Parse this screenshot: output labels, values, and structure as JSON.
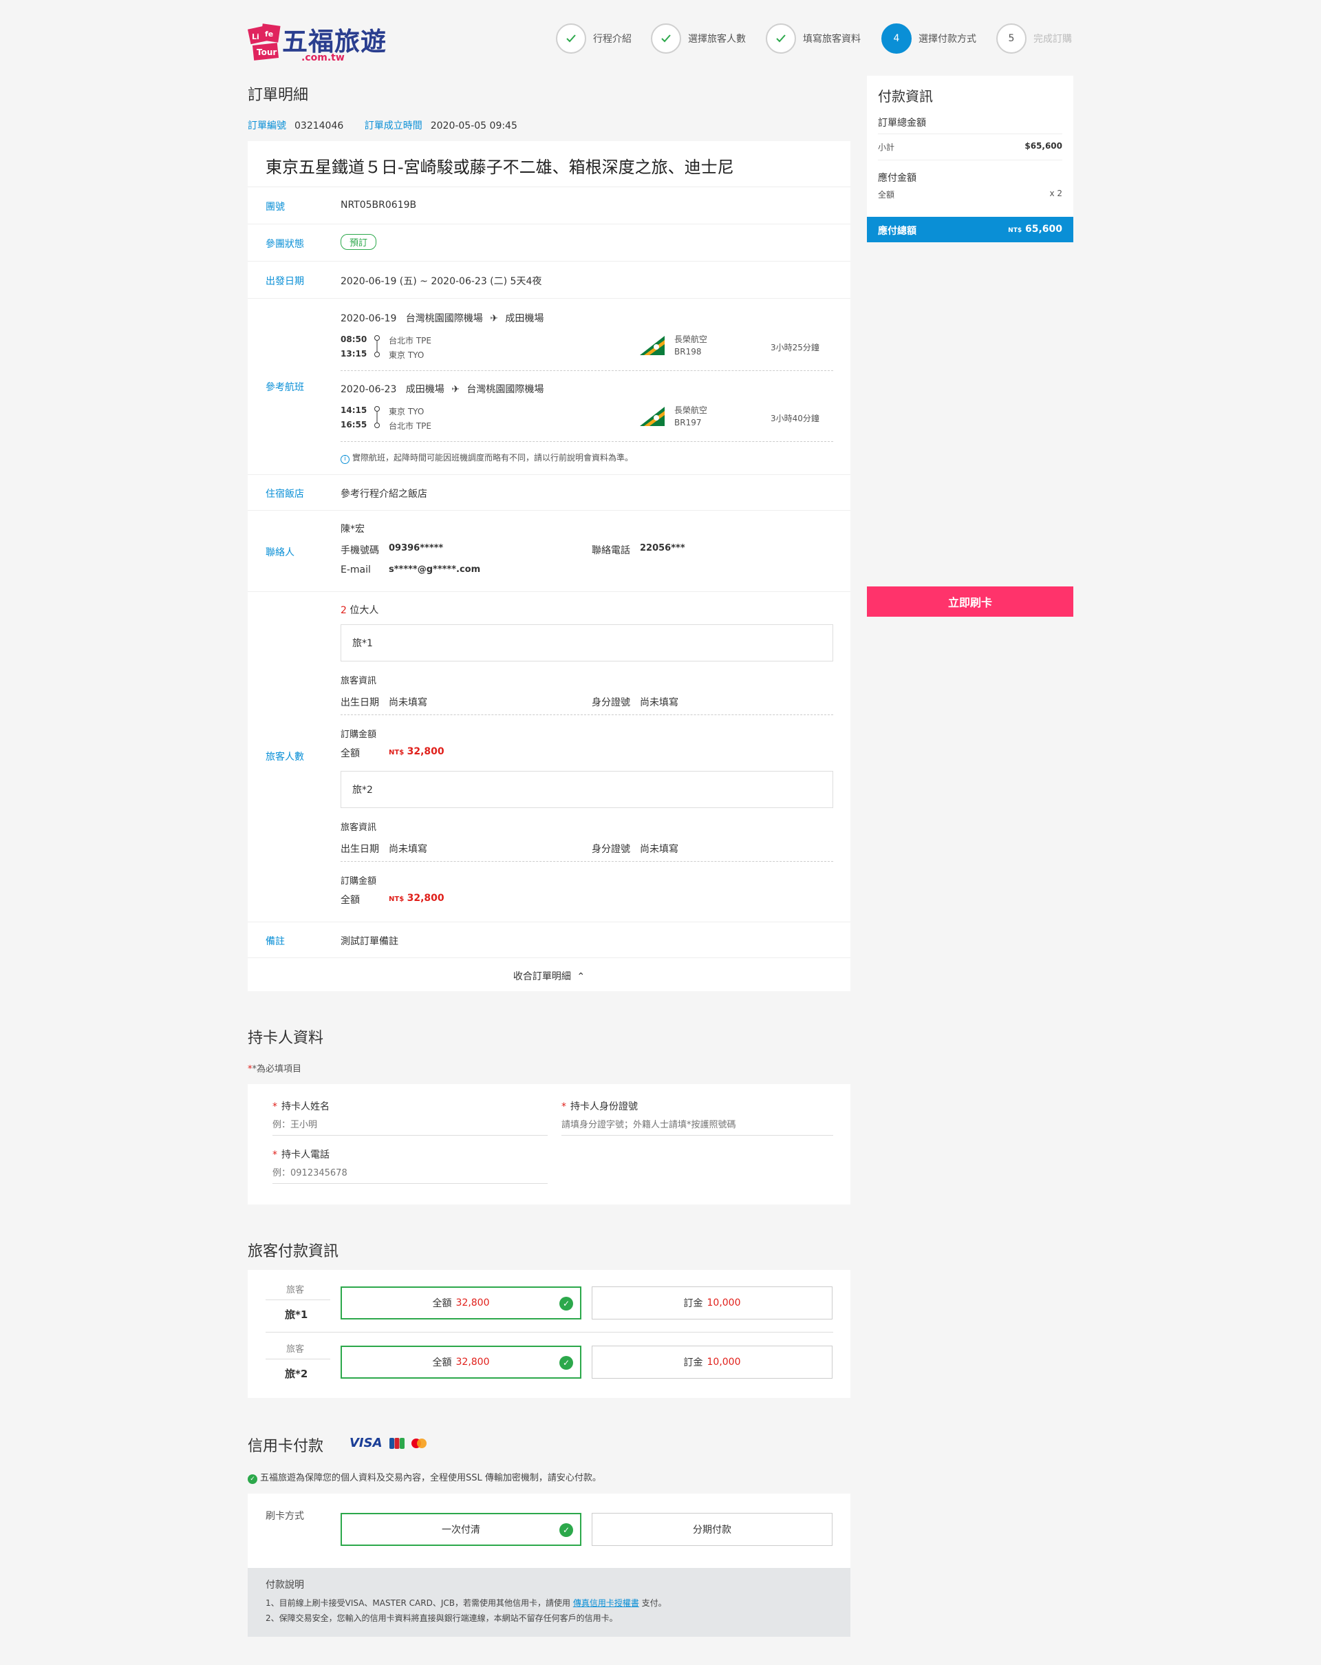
{
  "brand": {
    "logo_badge": "Life Tour",
    "name": "五福旅遊",
    "domain": ".com.tw"
  },
  "steps": [
    {
      "label": "行程介紹",
      "status": "done"
    },
    {
      "label": "選擇旅客人數",
      "status": "done"
    },
    {
      "label": "填寫旅客資料",
      "status": "done"
    },
    {
      "num": "4",
      "label": "選擇付款方式",
      "status": "active"
    },
    {
      "num": "5",
      "label": "完成訂購",
      "status": "pending"
    }
  ],
  "order": {
    "heading": "訂單明細",
    "id_label": "訂單編號",
    "id": "03214046",
    "created_label": "訂單成立時間",
    "created": "2020-05-05 09:45",
    "title": "東京五星鐵道５日-宮崎駿或藤子不二雄、箱根深度之旅、迪士尼",
    "group_label": "團號",
    "group": "NRT05BR0619B",
    "status_label": "參團狀態",
    "status": "預訂",
    "dates_label": "出發日期",
    "dates": "2020-06-19 (五) ~ 2020-06-23 (二) 5天4夜",
    "flights_label": "參考航班",
    "flights": [
      {
        "date": "2020-06-19",
        "from": "台灣桃園國際機場",
        "to": "成田機場",
        "dep_time": "08:50",
        "dep_place": "台北市 TPE",
        "arr_time": "13:15",
        "arr_place": "東京 TYO",
        "airline": "長榮航空",
        "code": "BR198",
        "duration": "3小時25分鐘"
      },
      {
        "date": "2020-06-23",
        "from": "成田機場",
        "to": "台灣桃園國際機場",
        "dep_time": "14:15",
        "dep_place": "東京 TYO",
        "arr_time": "16:55",
        "arr_place": "台北市 TPE",
        "airline": "長榮航空",
        "code": "BR197",
        "duration": "3小時40分鐘"
      }
    ],
    "flight_note": "實際航班，起降時間可能因班機調度而略有不同，請以行前說明會資料為準。",
    "hotel_label": "住宿飯店",
    "hotel": "參考行程介紹之飯店",
    "contact_label": "聯絡人",
    "contact": {
      "name": "陳*宏",
      "mobile_label": "手機號碼",
      "mobile": "09396*****",
      "phone_label": "聯絡電話",
      "phone": "22056***",
      "email_label": "E-mail",
      "email": "s*****@g*****.com"
    },
    "travelers_label": "旅客人數",
    "adult_count": "2",
    "adult_suffix": "位大人",
    "travelers": [
      {
        "name": "旅*1",
        "info_label": "旅客資訊",
        "birth_label": "出生日期",
        "birth": "尚未填寫",
        "idno_label": "身分證號",
        "idno": "尚未填寫",
        "amount_label": "訂購金額",
        "full_label": "全額",
        "currency": "NT$",
        "amount": "32,800"
      },
      {
        "name": "旅*2",
        "info_label": "旅客資訊",
        "birth_label": "出生日期",
        "birth": "尚未填寫",
        "idno_label": "身分證號",
        "idno": "尚未填寫",
        "amount_label": "訂購金額",
        "full_label": "全額",
        "currency": "NT$",
        "amount": "32,800"
      }
    ],
    "remark_label": "備註",
    "remark": "測試訂單備註",
    "collapse": "收合訂單明細"
  },
  "payment_info": {
    "heading": "付款資訊",
    "total_label": "訂單總金額",
    "subtotal_label": "小計",
    "subtotal": "$65,600",
    "due_label": "應付金額",
    "full_label": "全額",
    "qty": "x 2",
    "grand_label": "應付總額",
    "grand_currency": "NT$",
    "grand": "65,600",
    "swipe": "立即刷卡"
  },
  "cardholder": {
    "heading": "持卡人資料",
    "required_note": "*為必填項目",
    "name_label": "持卡人姓名",
    "name_ph": "例：王小明",
    "id_label": "持卡人身份證號",
    "id_ph": "請填身分證字號；外籍人士請填*按護照號碼",
    "phone_label": "持卡人電話",
    "phone_ph": "例：0912345678"
  },
  "traveler_payment": {
    "heading": "旅客付款資訊",
    "rows": [
      {
        "kind": "旅客",
        "name": "旅*1",
        "full_label": "全額",
        "full": "32,800",
        "deposit_label": "訂金",
        "deposit": "10,000"
      },
      {
        "kind": "旅客",
        "name": "旅*2",
        "full_label": "全額",
        "full": "32,800",
        "deposit_label": "訂金",
        "deposit": "10,000"
      }
    ]
  },
  "credit": {
    "heading": "信用卡付款",
    "brands": [
      "VISA",
      "JCB",
      "MasterCard"
    ],
    "secure_note": "五福旅遊為保障您的個人資料及交易內容，全程使用SSL 傳輸加密機制，請安心付款。",
    "method_label": "刷卡方式",
    "once": "一次付清",
    "installment": "分期付款",
    "notes_heading": "付款說明",
    "note1_a": "1、目前線上刷卡接受VISA、MASTER CARD、JCB，若需使用其他信用卡，請使用",
    "note1_link": "傳真信用卡授權書",
    "note1_b": "支付。",
    "note2": "2、保障交易安全，您輸入的信用卡資料將直接與銀行端連線，本網站不留存任何客戶的信用卡。"
  },
  "colors": {
    "accent": "#0a8fd6",
    "green": "#2ca84b",
    "red": "#e0201b",
    "pink": "#ff336b"
  }
}
